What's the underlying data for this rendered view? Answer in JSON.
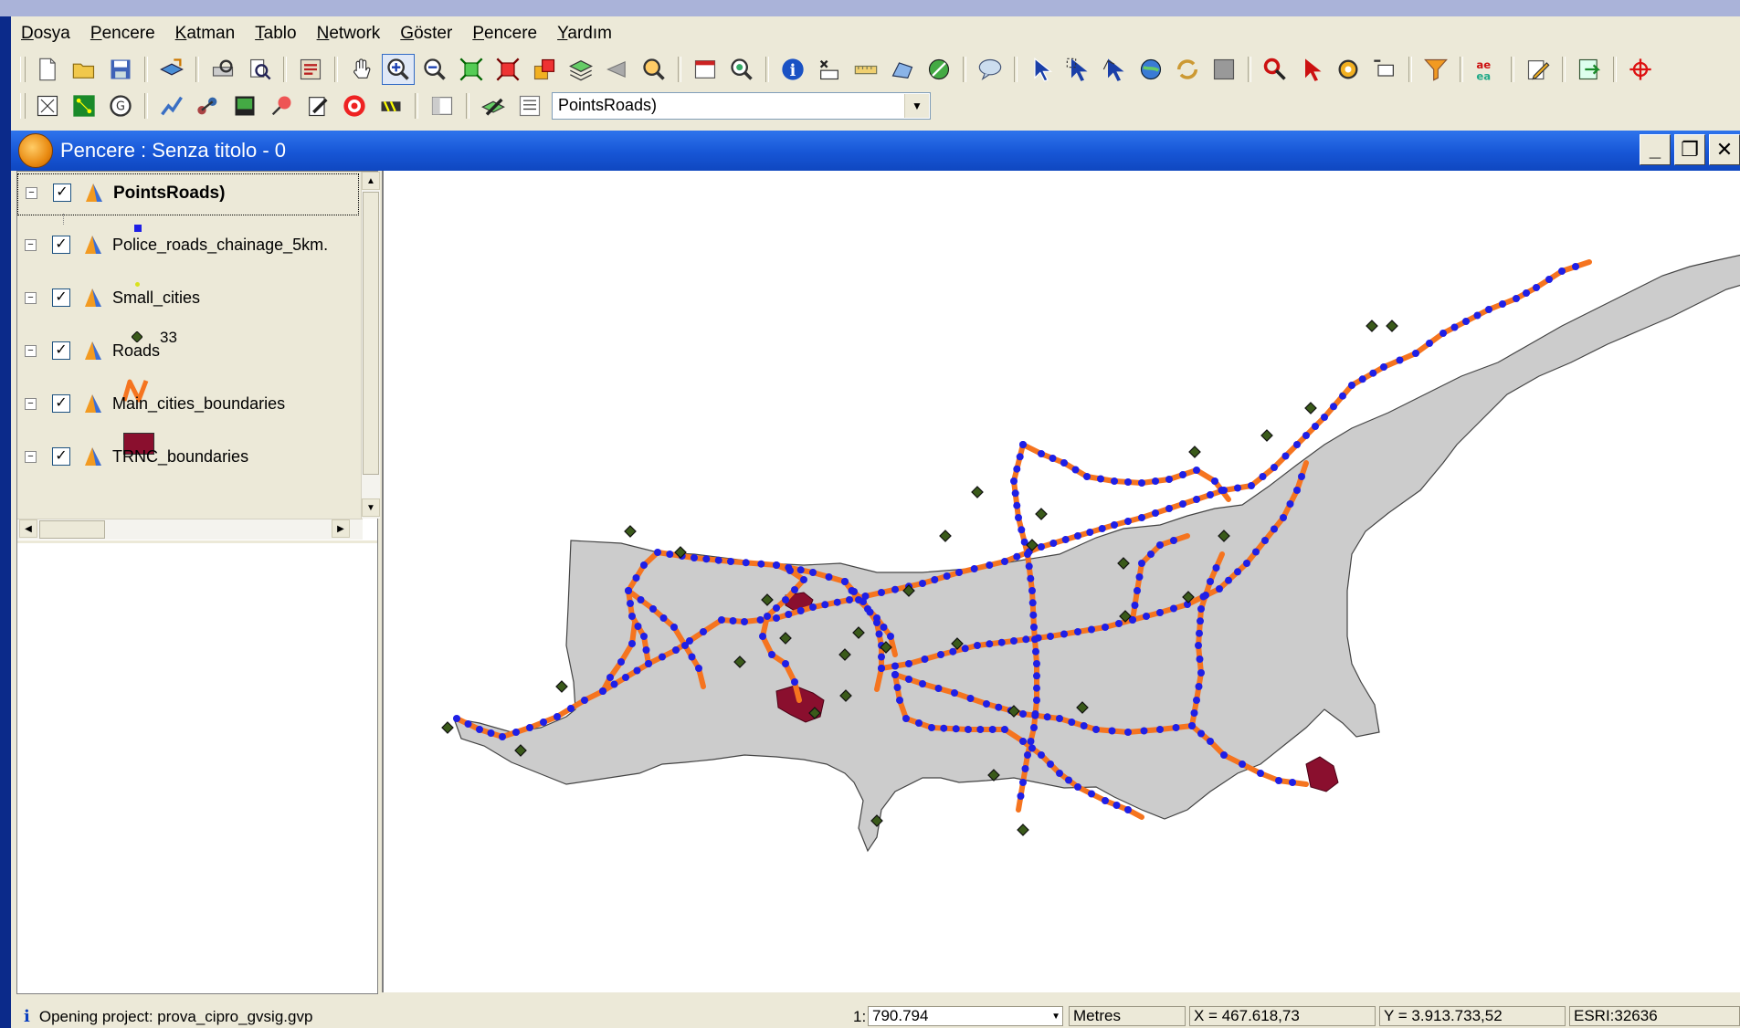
{
  "menu": [
    {
      "label": "Dosya",
      "ul": "D",
      "rest": "osya"
    },
    {
      "label": "Pencere",
      "ul": "P",
      "rest": "encere"
    },
    {
      "label": "Katman",
      "ul": "K",
      "rest": "atman"
    },
    {
      "label": "Tablo",
      "ul": "T",
      "rest": "ablo"
    },
    {
      "label": "Network",
      "ul": "N",
      "rest": "etwork"
    },
    {
      "label": "Göster",
      "ul": "G",
      "rest": "öster"
    },
    {
      "label": "Pencere",
      "ul": "P",
      "rest": "encere"
    },
    {
      "label": "Yardım",
      "ul": "Y",
      "rest": "ardım"
    }
  ],
  "toolbar": {
    "layer_select_value": "PointsRoads)"
  },
  "doc_window": {
    "title": "Pencere : Senza titolo - 0",
    "minimize": "_",
    "restore": "❐",
    "close": "✕"
  },
  "toc": {
    "layers": [
      {
        "name": "PointsRoads)",
        "active": true,
        "checked": "✓",
        "legend_type": "blue-square",
        "legend_label": ""
      },
      {
        "name": "Police_roads_chainage_5km.",
        "active": false,
        "checked": "✓",
        "legend_type": "yellow-dot",
        "legend_label": ""
      },
      {
        "name": "Small_cities",
        "active": false,
        "checked": "✓",
        "legend_type": "green-diamond",
        "legend_label": "33"
      },
      {
        "name": "Roads",
        "active": false,
        "checked": "✓",
        "legend_type": "orange-line",
        "legend_label": ""
      },
      {
        "name": "Main_cities_boundaries",
        "active": false,
        "checked": "✓",
        "legend_type": "maroon-fill",
        "legend_label": ""
      },
      {
        "name": "TRNC_boundaries",
        "active": false,
        "checked": "✓",
        "legend_type": "",
        "legend_label": ""
      }
    ]
  },
  "map": {
    "land_color": "#cccccc",
    "road_color": "#f5741f",
    "point_color": "#1f1fe6",
    "city_color": "#8a0f2e",
    "small_city_color": "#5a7a2a"
  },
  "status": {
    "message": "Opening project: prova_cipro_gvsig.gvp",
    "scale_prefix": "1:",
    "scale_value": "790.794",
    "units": "Metres",
    "x": "X = 467.618,73",
    "y": "Y = 3.913.733,52",
    "crs": "ESRI:32636"
  }
}
